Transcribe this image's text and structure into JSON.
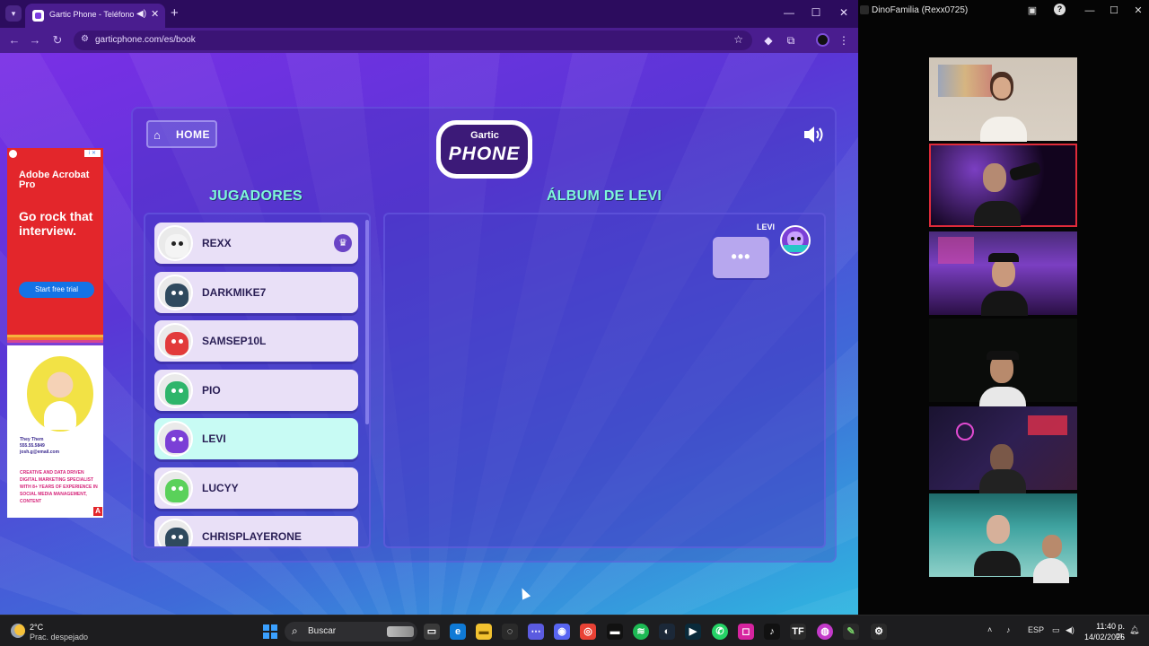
{
  "browser": {
    "tab_title": "Gartic Phone - Teléfono De",
    "url": "garticphone.com/es/book",
    "window_controls": {
      "minimize": "—",
      "maximize": "☐",
      "close": "✕"
    }
  },
  "ad": {
    "brand": "Adobe Acrobat Pro",
    "headline": "Go rock that interview.",
    "cta": "Start free trial",
    "contact": "They Them\n555.55.5849\njosh.g@email.com",
    "bio": "CREATIVE AND DATA DRIVEN DIGITAL MARKETING SPECIALIST WITH 8+ YEARS OF EXPERIENCE IN SOCIAL MEDIA MANAGEMENT, CONTENT",
    "adchoice_label": "i ✕",
    "ad_logo": "A"
  },
  "game": {
    "home_label": "HOME",
    "logo_top": "Gartic",
    "logo_main": "PHONE",
    "players_title": "JUGADORES",
    "album_title": "ÁLBUM DE LEVI",
    "album_owner": "LEVI",
    "typing_dots": "•••",
    "players": [
      {
        "name": "REXX",
        "host": true,
        "active": false,
        "color": "#f4f4f4"
      },
      {
        "name": "DARKMIKE7",
        "host": false,
        "active": false,
        "color": "#2f4a5e"
      },
      {
        "name": "SAMSEP10L",
        "host": false,
        "active": false,
        "color": "#e23b3b"
      },
      {
        "name": "PIO",
        "host": false,
        "active": false,
        "color": "#2fb56b"
      },
      {
        "name": "LEVI",
        "host": false,
        "active": true,
        "color": "#7b3fd6"
      },
      {
        "name": "LUCYY",
        "host": false,
        "active": false,
        "color": "#5ad15a"
      },
      {
        "name": "CHRISPLAYERONE",
        "host": false,
        "active": false,
        "color": "#2f4a5e"
      }
    ],
    "crown_icon": "♛"
  },
  "call": {
    "title": "DinoFamilia (Rexx0725)"
  },
  "taskbar": {
    "weather_temp": "2°C",
    "weather_desc": "Prac. despejado",
    "search_label": "Buscar",
    "language": "ESP",
    "time": "11:40 p. m.",
    "date": "14/02/2026"
  },
  "colors": {
    "accent_teal": "#7ff7d9",
    "panel_bg": "#5a36d6",
    "call_highlight": "#e02b3a"
  }
}
